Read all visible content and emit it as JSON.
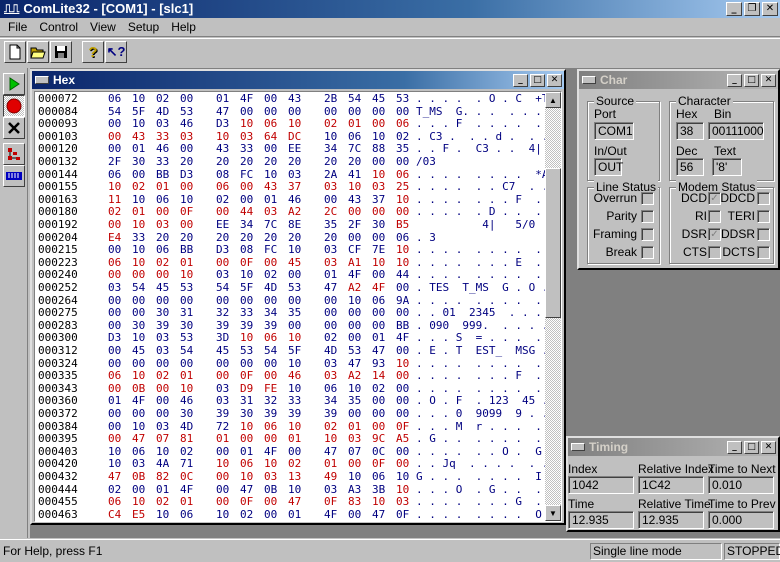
{
  "app": {
    "title": "ComLite32 - [COM1] - [slc1]",
    "app_icon": "signal-wave-icon"
  },
  "menu": [
    {
      "label": "File",
      "accel": "F"
    },
    {
      "label": "Control",
      "accel": "C"
    },
    {
      "label": "View",
      "accel": "V"
    },
    {
      "label": "Setup",
      "accel": "S"
    },
    {
      "label": "Help",
      "accel": "H"
    }
  ],
  "toolbar": [
    "new-file-icon",
    "open-folder-icon",
    "save-icon",
    "help-icon",
    "context-help-icon"
  ],
  "vtoolbar": [
    "run-icon",
    "record-icon",
    "stop-icon",
    "tree-view-icon",
    "ruler-icon"
  ],
  "hex_window": {
    "title": "Hex",
    "scroll_position": 0.24,
    "rows": [
      {
        "offset": "000072",
        "bytes": [
          "06",
          "10",
          "02",
          "00",
          "01",
          "4F",
          "00",
          "43",
          "2B",
          "54",
          "45",
          "53"
        ],
        "colors": "bbbbbbbbbbbb",
        "ascii": ". . . .  . O . C  +TES"
      },
      {
        "offset": "000084",
        "bytes": [
          "54",
          "5F",
          "4D",
          "53",
          "47",
          "00",
          "00",
          "00",
          "00",
          "00",
          "00",
          "00"
        ],
        "colors": "bbbbbbbbbbbb",
        "ascii": "T_MS  G. . .  . . . ."
      },
      {
        "offset": "000093",
        "bytes": [
          "00",
          "10",
          "03",
          "46",
          "D3",
          "10",
          "06",
          "10",
          "02",
          "01",
          "00",
          "06"
        ],
        "colors": "bbbbbrrrrrrr",
        "ascii": ". . . F  . . . .  . . . ."
      },
      {
        "offset": "000103",
        "bytes": [
          "00",
          "43",
          "33",
          "03",
          "10",
          "03",
          "64",
          "DC",
          "10",
          "06",
          "10",
          "02"
        ],
        "colors": "rrrrrrrrbbbb",
        "ascii": ". C3 .  . . d .  . . . ."
      },
      {
        "offset": "000120",
        "bytes": [
          "00",
          "01",
          "46",
          "00",
          "43",
          "33",
          "00",
          "EE",
          "34",
          "7C",
          "88",
          "35"
        ],
        "colors": "bbbbbbbbbbbb",
        "ascii": ". . F .  C3 . .  4| . 5"
      },
      {
        "offset": "000132",
        "bytes": [
          "2F",
          "30",
          "33",
          "20",
          "20",
          "20",
          "20",
          "20",
          "20",
          "20",
          "00",
          "00"
        ],
        "colors": "bbbbbbbbbbbb",
        "ascii": "/03                 . ."
      },
      {
        "offset": "000144",
        "bytes": [
          "06",
          "00",
          "BB",
          "D3",
          "08",
          "FC",
          "10",
          "03",
          "2A",
          "41",
          "10",
          "06"
        ],
        "colors": "bbbbbbbbbbrr",
        "ascii": ". . . .  . . . .  *A . ."
      },
      {
        "offset": "000155",
        "bytes": [
          "10",
          "02",
          "01",
          "00",
          "06",
          "00",
          "43",
          "37",
          "03",
          "10",
          "03",
          "25"
        ],
        "colors": "rrrrrrrrrrrr",
        "ascii": ". . . .  . . C7  . . . %"
      },
      {
        "offset": "000163",
        "bytes": [
          "11",
          "10",
          "06",
          "10",
          "02",
          "00",
          "01",
          "46",
          "00",
          "43",
          "37",
          "10"
        ],
        "colors": "rbbbbbbbbbbr",
        "ascii": ". . . .  . . . F  . C7 ."
      },
      {
        "offset": "000180",
        "bytes": [
          "02",
          "01",
          "00",
          "0F",
          "00",
          "44",
          "03",
          "A2",
          "2C",
          "00",
          "00",
          "00"
        ],
        "colors": "rrrrrrrrrrrr",
        "ascii": ". . . .  . D . .  . . . ."
      },
      {
        "offset": "000192",
        "bytes": [
          "00",
          "10",
          "03",
          "00",
          "EE",
          "34",
          "7C",
          "8E",
          "35",
          "2F",
          "30",
          "B5"
        ],
        "colors": "rrrrbbbbbbbr",
        "ascii": "          4|   5/0"
      },
      {
        "offset": "000204",
        "bytes": [
          "E4",
          "33",
          "20",
          "20",
          "20",
          "20",
          "20",
          "20",
          "20",
          "00",
          "00",
          "06"
        ],
        "colors": "rbbbbbbbbbbb",
        "ascii": ". 3                 . . ."
      },
      {
        "offset": "000215",
        "bytes": [
          "00",
          "10",
          "06",
          "BB",
          "D3",
          "08",
          "FC",
          "10",
          "03",
          "CF",
          "7E",
          "10"
        ],
        "colors": "bbbbbbbbbbbr",
        "ascii": ". . . .  . . . .  . . ~ ."
      },
      {
        "offset": "000223",
        "bytes": [
          "06",
          "10",
          "02",
          "01",
          "00",
          "0F",
          "00",
          "45",
          "03",
          "A1",
          "10",
          "10"
        ],
        "colors": "rrrrrrrrrrrr",
        "ascii": ". . . .  . . . E  . . . ."
      },
      {
        "offset": "000240",
        "bytes": [
          "00",
          "00",
          "00",
          "10",
          "03",
          "10",
          "02",
          "00",
          "01",
          "4F",
          "00",
          "44"
        ],
        "colors": "rrrrbbbbbbbb",
        "ascii": ". . . .  . . . .  . O . D"
      },
      {
        "offset": "000252",
        "bytes": [
          "03",
          "54",
          "45",
          "53",
          "54",
          "5F",
          "4D",
          "53",
          "47",
          "A2",
          "4F",
          "00"
        ],
        "colors": "bbbbbbbbbrrb",
        "ascii": ". TES  T_MS  G . O ."
      },
      {
        "offset": "000264",
        "bytes": [
          "00",
          "00",
          "00",
          "00",
          "00",
          "00",
          "00",
          "00",
          "00",
          "10",
          "06",
          "9A"
        ],
        "colors": "bbbbbbbbbbbb",
        "ascii": ". . . .  . . . .  . . . ."
      },
      {
        "offset": "000275",
        "bytes": [
          "00",
          "00",
          "30",
          "31",
          "32",
          "33",
          "34",
          "35",
          "00",
          "00",
          "00",
          "00"
        ],
        "colors": "bbbbbbbbbbbb",
        "ascii": ". . 01  2345  . . . ."
      },
      {
        "offset": "000283",
        "bytes": [
          "00",
          "30",
          "39",
          "30",
          "39",
          "39",
          "39",
          "00",
          "00",
          "00",
          "00",
          "BB"
        ],
        "colors": "bbbbbbbbbbbb",
        "ascii": ". 090  999.  . . . ."
      },
      {
        "offset": "000300",
        "bytes": [
          "D3",
          "10",
          "03",
          "53",
          "3D",
          "10",
          "06",
          "10",
          "02",
          "00",
          "01",
          "4F"
        ],
        "colors": "bbbbbrrrbbbb",
        "ascii": ". . . S  = . . .  . . . O"
      },
      {
        "offset": "000312",
        "bytes": [
          "00",
          "45",
          "03",
          "54",
          "45",
          "53",
          "54",
          "5F",
          "4D",
          "53",
          "47",
          "00"
        ],
        "colors": "bbbbbbbbbbbb",
        "ascii": ". E . T  EST_  MSG ."
      },
      {
        "offset": "000324",
        "bytes": [
          "00",
          "00",
          "00",
          "00",
          "00",
          "00",
          "00",
          "10",
          "03",
          "47",
          "93",
          "10"
        ],
        "colors": "bbbbbbbbbbbr",
        "ascii": ". . . .  . . . .  . G . ."
      },
      {
        "offset": "000335",
        "bytes": [
          "06",
          "10",
          "02",
          "01",
          "00",
          "0F",
          "00",
          "46",
          "03",
          "A2",
          "14",
          "00"
        ],
        "colors": "rrrrrrrrrrrr",
        "ascii": ". . . .  . . . F  . . . ."
      },
      {
        "offset": "000343",
        "bytes": [
          "00",
          "0B",
          "00",
          "10",
          "03",
          "D9",
          "FE",
          "10",
          "06",
          "10",
          "02",
          "00"
        ],
        "colors": "rrrrbrrbbbbb",
        "ascii": ". . . .  . . . .  . . . ."
      },
      {
        "offset": "000360",
        "bytes": [
          "01",
          "4F",
          "00",
          "46",
          "03",
          "31",
          "32",
          "33",
          "34",
          "35",
          "00",
          "00"
        ],
        "colors": "bbbbbbbbbbbb",
        "ascii": ". O . F  . 123  45 . ."
      },
      {
        "offset": "000372",
        "bytes": [
          "00",
          "00",
          "00",
          "30",
          "39",
          "30",
          "39",
          "39",
          "39",
          "00",
          "00",
          "00"
        ],
        "colors": "bbbbbbbbbbbb",
        "ascii": ". . . 0  9099  9 . . ."
      },
      {
        "offset": "000384",
        "bytes": [
          "00",
          "10",
          "03",
          "4D",
          "72",
          "10",
          "06",
          "10",
          "02",
          "01",
          "00",
          "0F"
        ],
        "colors": "bbbbbrrrrrrr",
        "ascii": ". . . M  r . . .  . . . ."
      },
      {
        "offset": "000395",
        "bytes": [
          "00",
          "47",
          "07",
          "81",
          "01",
          "00",
          "00",
          "01",
          "10",
          "03",
          "9C",
          "A5"
        ],
        "colors": "rrrrrrrrrrrr",
        "ascii": ". G . .  . . . .  . . . ."
      },
      {
        "offset": "000403",
        "bytes": [
          "10",
          "06",
          "10",
          "02",
          "00",
          "01",
          "4F",
          "00",
          "47",
          "07",
          "0C",
          "00"
        ],
        "colors": "bbbbbbbbbbbb",
        "ascii": ". . . .  . . O .  G . . ."
      },
      {
        "offset": "000420",
        "bytes": [
          "10",
          "03",
          "4A",
          "71",
          "10",
          "06",
          "10",
          "02",
          "01",
          "00",
          "0F",
          "00"
        ],
        "colors": "bbbbrrrrrrrr",
        "ascii": ". . Jq  . . . .  . . . ."
      },
      {
        "offset": "000432",
        "bytes": [
          "47",
          "0B",
          "82",
          "0C",
          "00",
          "10",
          "03",
          "13",
          "49",
          "10",
          "06",
          "10"
        ],
        "colors": "rrrrrrrrrbbb",
        "ascii": "G . . .  . . . .  I . . ."
      },
      {
        "offset": "000444",
        "bytes": [
          "02",
          "00",
          "01",
          "4F",
          "00",
          "47",
          "0B",
          "10",
          "03",
          "A3",
          "3B",
          "10"
        ],
        "colors": "bbbbbbbbbbbr",
        "ascii": ". . . O  . G . .  . . ; ."
      },
      {
        "offset": "000455",
        "bytes": [
          "06",
          "10",
          "02",
          "01",
          "00",
          "0F",
          "00",
          "47",
          "0F",
          "83",
          "10",
          "03"
        ],
        "colors": "rrrrrrrrrrrr",
        "ascii": ". . . .  . . . G  . . . ."
      },
      {
        "offset": "000463",
        "bytes": [
          "C4",
          "E5",
          "10",
          "06",
          "10",
          "02",
          "00",
          "01",
          "4F",
          "00",
          "47",
          "0F"
        ],
        "colors": "rrbbbbbbbbbb",
        "ascii": ". . . .  . . . .  O . G ."
      }
    ]
  },
  "char_window": {
    "title": "Char",
    "source": {
      "label": "Source",
      "port_label": "Port",
      "port_value": "COM1",
      "inout_label": "In/Out",
      "inout_value": "OUT"
    },
    "character": {
      "label": "Character",
      "hex_label": "Hex",
      "hex_value": "38",
      "bin_label": "Bin",
      "bin_value": "00111000",
      "dec_label": "Dec",
      "dec_value": "56",
      "text_label": "Text",
      "text_value": "'8'"
    },
    "line_status": {
      "label": "Line Status",
      "items": [
        {
          "label": "Overrun",
          "checked": false
        },
        {
          "label": "Parity",
          "checked": false
        },
        {
          "label": "Framing",
          "checked": false
        },
        {
          "label": "Break",
          "checked": false
        }
      ]
    },
    "modem_status": {
      "label": "Modem Status",
      "left": [
        {
          "label": "DCD",
          "checked": true
        },
        {
          "label": "RI",
          "checked": false
        },
        {
          "label": "DSR",
          "checked": true
        },
        {
          "label": "CTS",
          "checked": false
        }
      ],
      "right": [
        {
          "label": "DDCD",
          "checked": false
        },
        {
          "label": "TERI",
          "checked": false
        },
        {
          "label": "DDSR",
          "checked": false
        },
        {
          "label": "DCTS",
          "checked": false
        }
      ]
    }
  },
  "timing_window": {
    "title": "Timing",
    "index_label": "Index",
    "index_value": "1042",
    "rel_index_label": "Relative Index",
    "rel_index_value": "1C42",
    "time_next_label": "Time to Next",
    "time_next_value": "0.010",
    "time_label": "Time",
    "time_value": "12.935",
    "rel_time_label": "Relative Time",
    "rel_time_value": "12.935",
    "time_prev_label": "Time to Prev",
    "time_prev_value": "0.000"
  },
  "status_bar": {
    "help": "For Help, press F1",
    "mode": "Single line mode",
    "state": "STOPPED"
  },
  "colors": {
    "byte_blue": "#000080",
    "byte_red": "#c00000",
    "title_active": "#0a246a",
    "title_inactive": "#808080"
  }
}
